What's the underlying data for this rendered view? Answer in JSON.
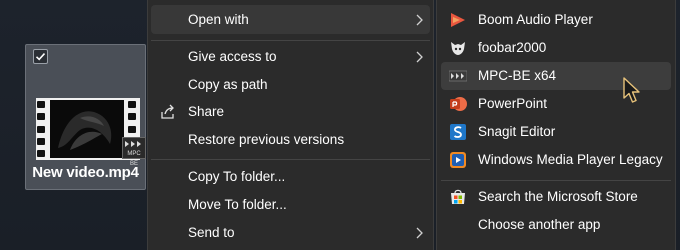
{
  "desktop": {
    "file": {
      "name": "New video.mp4",
      "badge": "MPC BE"
    }
  },
  "context_menu": {
    "items": [
      {
        "label": "Open with",
        "has_submenu": true,
        "highlighted": true
      },
      {
        "label": "Give access to",
        "has_submenu": true
      },
      {
        "label": "Copy as path"
      },
      {
        "label": "Share",
        "icon": "share-icon"
      },
      {
        "label": "Restore previous versions"
      },
      {
        "label": "Copy To folder..."
      },
      {
        "label": "Move To folder..."
      },
      {
        "label": "Send to",
        "has_submenu": true
      }
    ]
  },
  "open_with_submenu": {
    "apps": [
      {
        "label": "Boom Audio Player",
        "icon": "boom-audio-icon"
      },
      {
        "label": "foobar2000",
        "icon": "foobar2000-icon"
      },
      {
        "label": "MPC-BE x64",
        "icon": "mpc-be-icon",
        "highlighted": true
      },
      {
        "label": "PowerPoint",
        "icon": "powerpoint-icon"
      },
      {
        "label": "Snagit Editor",
        "icon": "snagit-icon"
      },
      {
        "label": "Windows Media Player Legacy",
        "icon": "windows-media-player-icon"
      }
    ],
    "extra": [
      {
        "label": "Search the Microsoft Store",
        "icon": "microsoft-store-icon"
      },
      {
        "label": "Choose another app"
      }
    ]
  },
  "colors": {
    "menu_bg": "#2b2b2b",
    "highlight": "#383838",
    "text": "#ffffff",
    "desktop_bg": "#1c2129"
  }
}
